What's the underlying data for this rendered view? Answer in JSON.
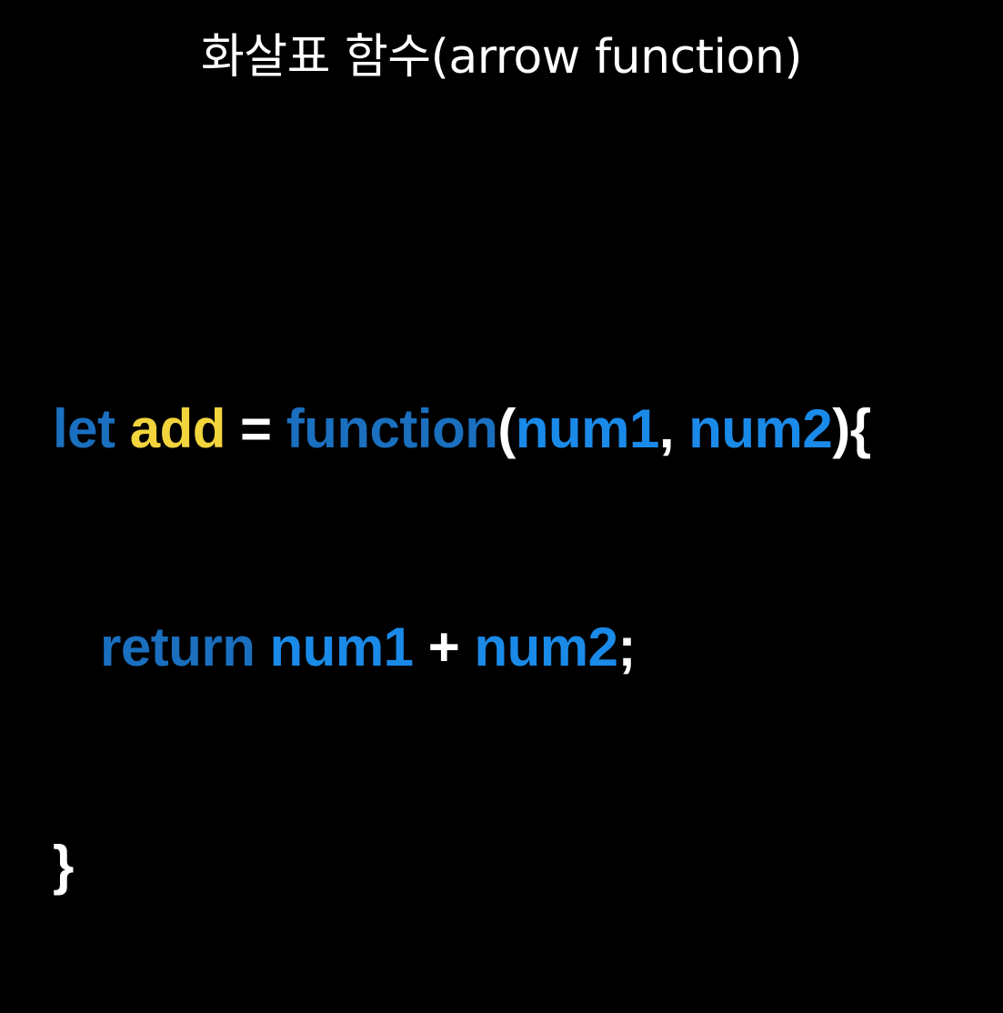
{
  "title": "화살표 함수(arrow function)",
  "code": {
    "line1": {
      "keyword_let": "let",
      "func_name": "add",
      "equals": "=",
      "keyword_function": "function",
      "open_paren": "(",
      "param1": "num1",
      "comma": ",",
      "param2": "num2",
      "close_paren_brace": "){"
    },
    "line2": {
      "keyword_return": "return",
      "var1": "num1",
      "plus": "+",
      "var2": "num2",
      "semicolon": ";"
    },
    "line3": {
      "close_brace": "}"
    }
  },
  "colors": {
    "background": "#000000",
    "title": "#ffffff",
    "keyword": "#1a6fbf",
    "function_name": "#f2d43c",
    "variable": "#1a8ae8",
    "punctuation": "#ffffff"
  }
}
